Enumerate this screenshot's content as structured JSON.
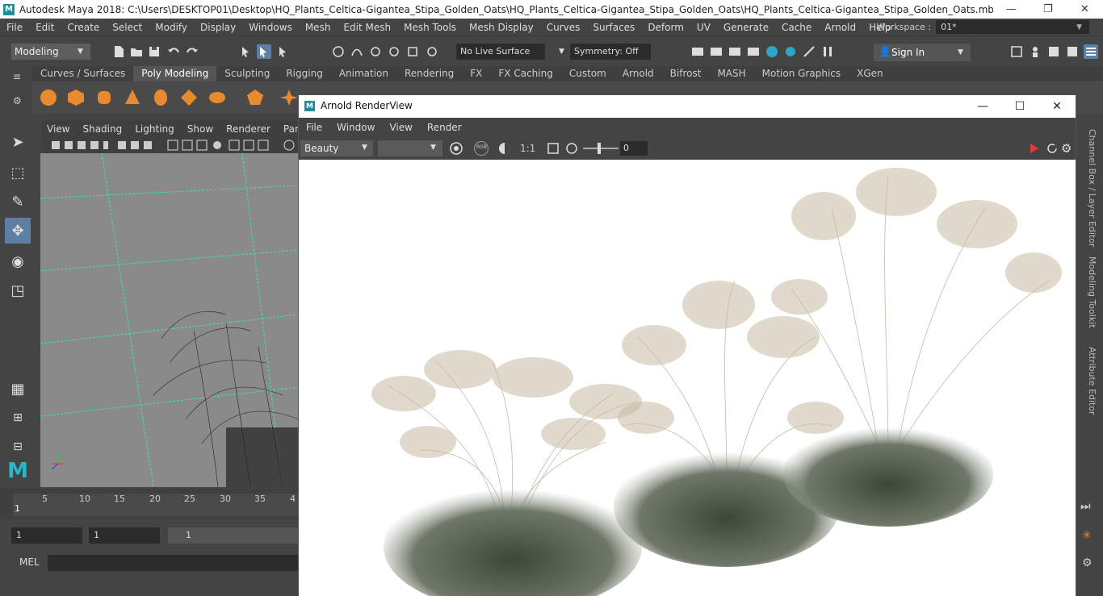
{
  "window": {
    "title": "Autodesk Maya 2018: C:\\Users\\DESKTOP01\\Desktop\\HQ_Plants_Celtica-Gigantea_Stipa_Golden_Oats\\HQ_Plants_Celtica-Gigantea_Stipa_Golden_Oats\\HQ_Plants_Celtica-Gigantea_Stipa_Golden_Oats.mb*  ---  aiSkyDomeLightS...",
    "logo": "M",
    "minimize": "—",
    "maximize": "❐",
    "close": "✕"
  },
  "menubar": {
    "items": [
      "File",
      "Edit",
      "Create",
      "Select",
      "Modify",
      "Display",
      "Windows",
      "Mesh",
      "Edit Mesh",
      "Mesh Tools",
      "Mesh Display",
      "Curves",
      "Surfaces",
      "Deform",
      "UV",
      "Generate",
      "Cache",
      "Arnold",
      "Help"
    ],
    "workspace_label": "Workspace :",
    "workspace_value": "01*"
  },
  "statusline": {
    "mode": "Modeling",
    "live_surface": "No Live Surface",
    "symmetry": "Symmetry: Off",
    "sign_in": "Sign In"
  },
  "shelf": {
    "tabs": [
      "Curves / Surfaces",
      "Poly Modeling",
      "Sculpting",
      "Rigging",
      "Animation",
      "Rendering",
      "FX",
      "FX Caching",
      "Custom",
      "Arnold",
      "Bifrost",
      "MASH",
      "Motion Graphics",
      "XGen"
    ],
    "active_tab": "Poly Modeling"
  },
  "viewport": {
    "menu": [
      "View",
      "Shading",
      "Lighting",
      "Show",
      "Renderer",
      "Panels"
    ]
  },
  "timeslider": {
    "ticks": [
      "5",
      "10",
      "15",
      "20",
      "25",
      "30",
      "35",
      "4"
    ],
    "current_frame": "1"
  },
  "range": {
    "start": "1",
    "current": "1",
    "anim_start": "1"
  },
  "cmdline": {
    "label": "MEL"
  },
  "rightpanel": {
    "tabs": [
      "Channel Box / Layer Editor",
      "Modeling Toolkit",
      "Attribute Editor"
    ]
  },
  "renderview": {
    "title": "Arnold RenderView",
    "logo": "M",
    "menu": [
      "File",
      "Window",
      "View",
      "Render"
    ],
    "aov": "Beauty",
    "camera": "",
    "ratio": "1:1",
    "exposure": "0",
    "rgb_label": "RGB"
  },
  "colors": {
    "accent_teal": "#1c8e9e",
    "active_tool": "#5d7fa3",
    "grid_line": "#39e6b8",
    "render_stop": "#e0383d"
  }
}
